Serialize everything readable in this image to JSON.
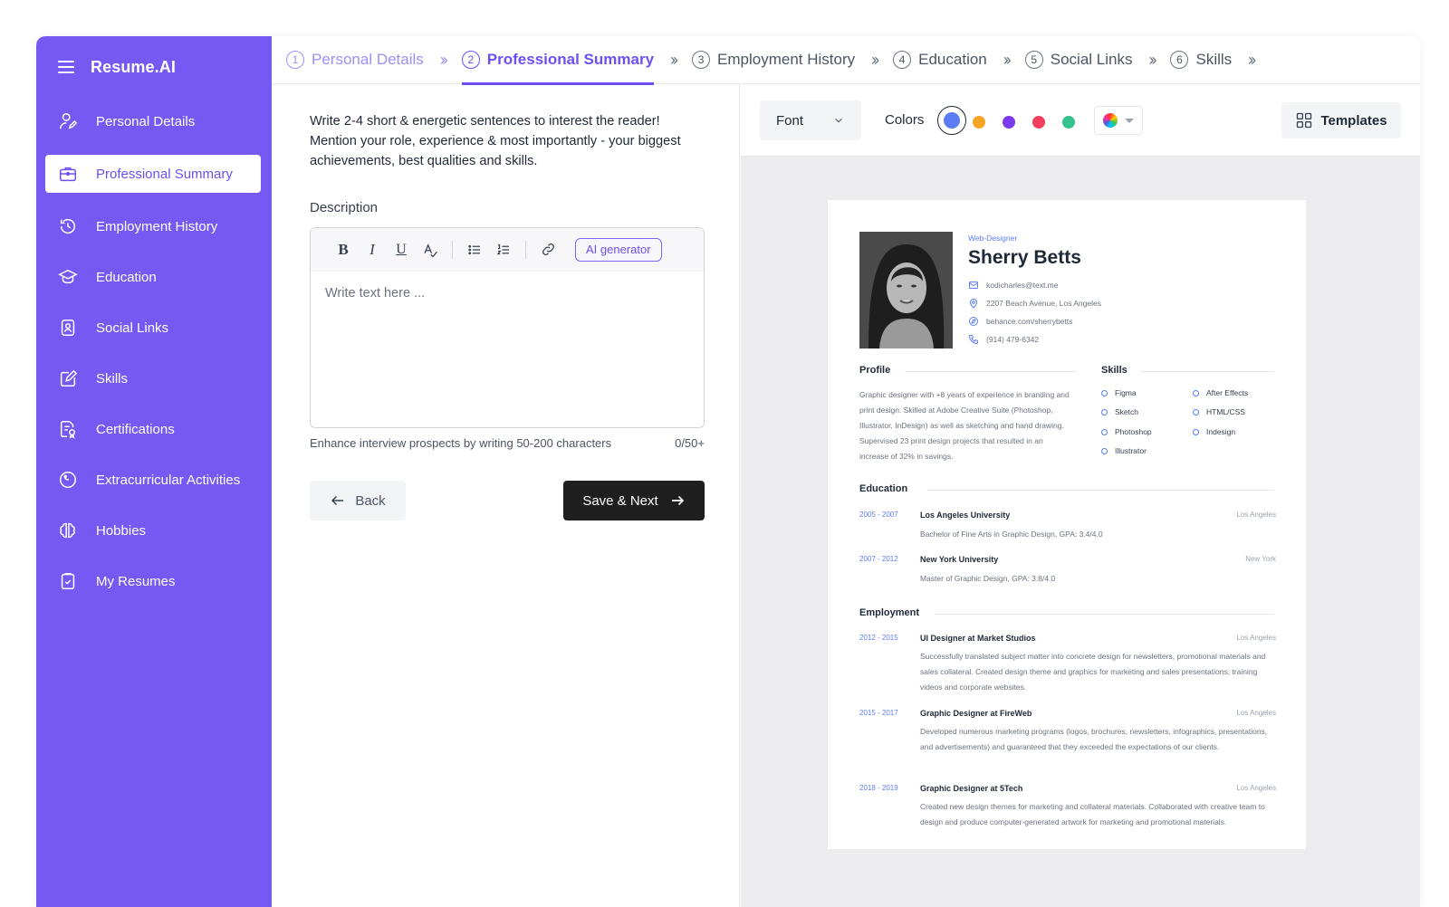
{
  "app": {
    "name": "Resume.AI"
  },
  "sidebar": {
    "items": [
      {
        "label": "Personal Details",
        "icon": "user-edit-icon",
        "active": false
      },
      {
        "label": "Professional Summary",
        "icon": "briefcase-icon",
        "active": true
      },
      {
        "label": "Employment History",
        "icon": "history-icon",
        "active": false
      },
      {
        "label": "Education",
        "icon": "graduation-cap-icon",
        "active": false
      },
      {
        "label": "Social Links",
        "icon": "social-badge-icon",
        "active": false
      },
      {
        "label": "Skills",
        "icon": "pencil-circle-icon",
        "active": false
      },
      {
        "label": "Certifications",
        "icon": "certificate-icon",
        "active": false
      },
      {
        "label": "Extracurricular Activities",
        "icon": "activity-icon",
        "active": false
      },
      {
        "label": "Hobbies",
        "icon": "brain-icon",
        "active": false
      },
      {
        "label": "My Resumes",
        "icon": "clipboard-check-icon",
        "active": false
      }
    ]
  },
  "steps": [
    {
      "num": "1",
      "label": "Personal Details",
      "state": "done"
    },
    {
      "num": "2",
      "label": "Professional Summary",
      "state": "current"
    },
    {
      "num": "3",
      "label": "Employment History",
      "state": "todo"
    },
    {
      "num": "4",
      "label": "Education",
      "state": "todo"
    },
    {
      "num": "5",
      "label": "Social Links",
      "state": "todo"
    },
    {
      "num": "6",
      "label": "Skills",
      "state": "todo"
    }
  ],
  "form": {
    "intro": "Write 2-4 short & energetic sentences to interest the reader! Mention your role, experience & most importantly - your biggest achievements, best qualities and skills.",
    "description_label": "Description",
    "ai_generator": "AI generator",
    "placeholder": "Write text here ...",
    "helper": "Enhance interview prospects by writing 50-200 characters",
    "counter": "0/50+",
    "back": "Back",
    "next": "Save & Next"
  },
  "preview": {
    "font_label": "Font",
    "colors_label": "Colors",
    "colors": [
      "#5b7cf2",
      "#f5a524",
      "#7c3aed",
      "#f43f5e",
      "#34c38f"
    ],
    "templates_label": "Templates",
    "resume": {
      "role": "Web-Designer",
      "name": "Sherry Betts",
      "email": "kodicharles@text.me",
      "address": "2207 Beach Avenue, Los Angeles",
      "website": "behance.com/sherrybetts",
      "phone": "(914) 479-6342",
      "profile_title": "Profile",
      "profile_text": "Graphic designer with +8 years of experience in branding and print design. Skilled at Adobe Creative Suite (Photoshop, Illustrator, InDesign) as well as sketching and hand drawing. Supervised 23 print design projects that resulted in an increase of 32% in savings.",
      "skills_title": "Skills",
      "skills": [
        "Figma",
        "Sketch",
        "Photoshop",
        "Illustrator",
        "After Effects",
        "HTML/CSS",
        "Indesign"
      ],
      "education_title": "Education",
      "education": [
        {
          "dates": "2005 - 2007",
          "school": "Los Angeles University",
          "location": "Los Angeles",
          "degree": "Bachelor of Fine Arts in Graphic Design, GPA: 3.4/4.0"
        },
        {
          "dates": "2007 - 2012",
          "school": "New York University",
          "location": "New York",
          "degree": "Master of Graphic Design, GPA: 3.8/4.0"
        }
      ],
      "employment_title": "Employment",
      "employment": [
        {
          "dates": "2012 - 2015",
          "title": "UI Designer at Market Studios",
          "location": "Los Angeles",
          "text": "Successfully translated subject matter into concrete design for newsletters, promotional materials and sales collateral. Created design theme and graphics for marketing and sales presentations, training videos and corporate websites."
        },
        {
          "dates": "2015 - 2017",
          "title": "Graphic Designer at FireWeb",
          "location": "Los Angeles",
          "text": "Developed numerous marketing programs (logos, brochures, newsletters, infographics, presentations, and advertisements) and guaranteed that they exceeded the expectations of our clients."
        },
        {
          "dates": "2018 - 2019",
          "title": "Graphic Designer at 5Tech",
          "location": "Los Angeles",
          "text": "Created new design themes for marketing and collateral materials. Collaborated with creative team to design and produce computer-generated artwork for marketing and promotional materials."
        }
      ]
    }
  }
}
